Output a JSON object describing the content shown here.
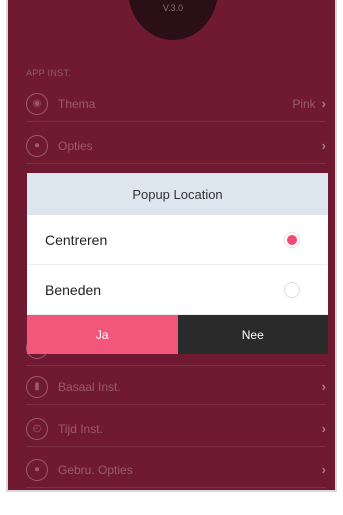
{
  "header": {
    "version": "V.3.0"
  },
  "section": {
    "title": "APP INST."
  },
  "rows": [
    {
      "label": "Thema",
      "value": "Pink",
      "icon": "eye-icon"
    },
    {
      "label": "Opties",
      "value": "",
      "icon": "user-icon"
    },
    {
      "label": "",
      "value": "",
      "icon": "unknown-icon"
    },
    {
      "label": "Basaal Inst.",
      "value": "",
      "icon": "bar-chart-icon"
    },
    {
      "label": "Tijd Inst.",
      "value": "",
      "icon": "clock-icon"
    },
    {
      "label": "Gebru. Opties",
      "value": "",
      "icon": "user-icon"
    }
  ],
  "dialog": {
    "title": "Popup Location",
    "options": [
      {
        "label": "Centreren",
        "selected": true
      },
      {
        "label": "Beneden",
        "selected": false
      }
    ],
    "yes_label": "Ja",
    "no_label": "Nee"
  },
  "colors": {
    "background": "#701a32",
    "accent": "#f2567b",
    "dark_button": "#2a2a2a",
    "dialog_header": "#dde5ee"
  }
}
